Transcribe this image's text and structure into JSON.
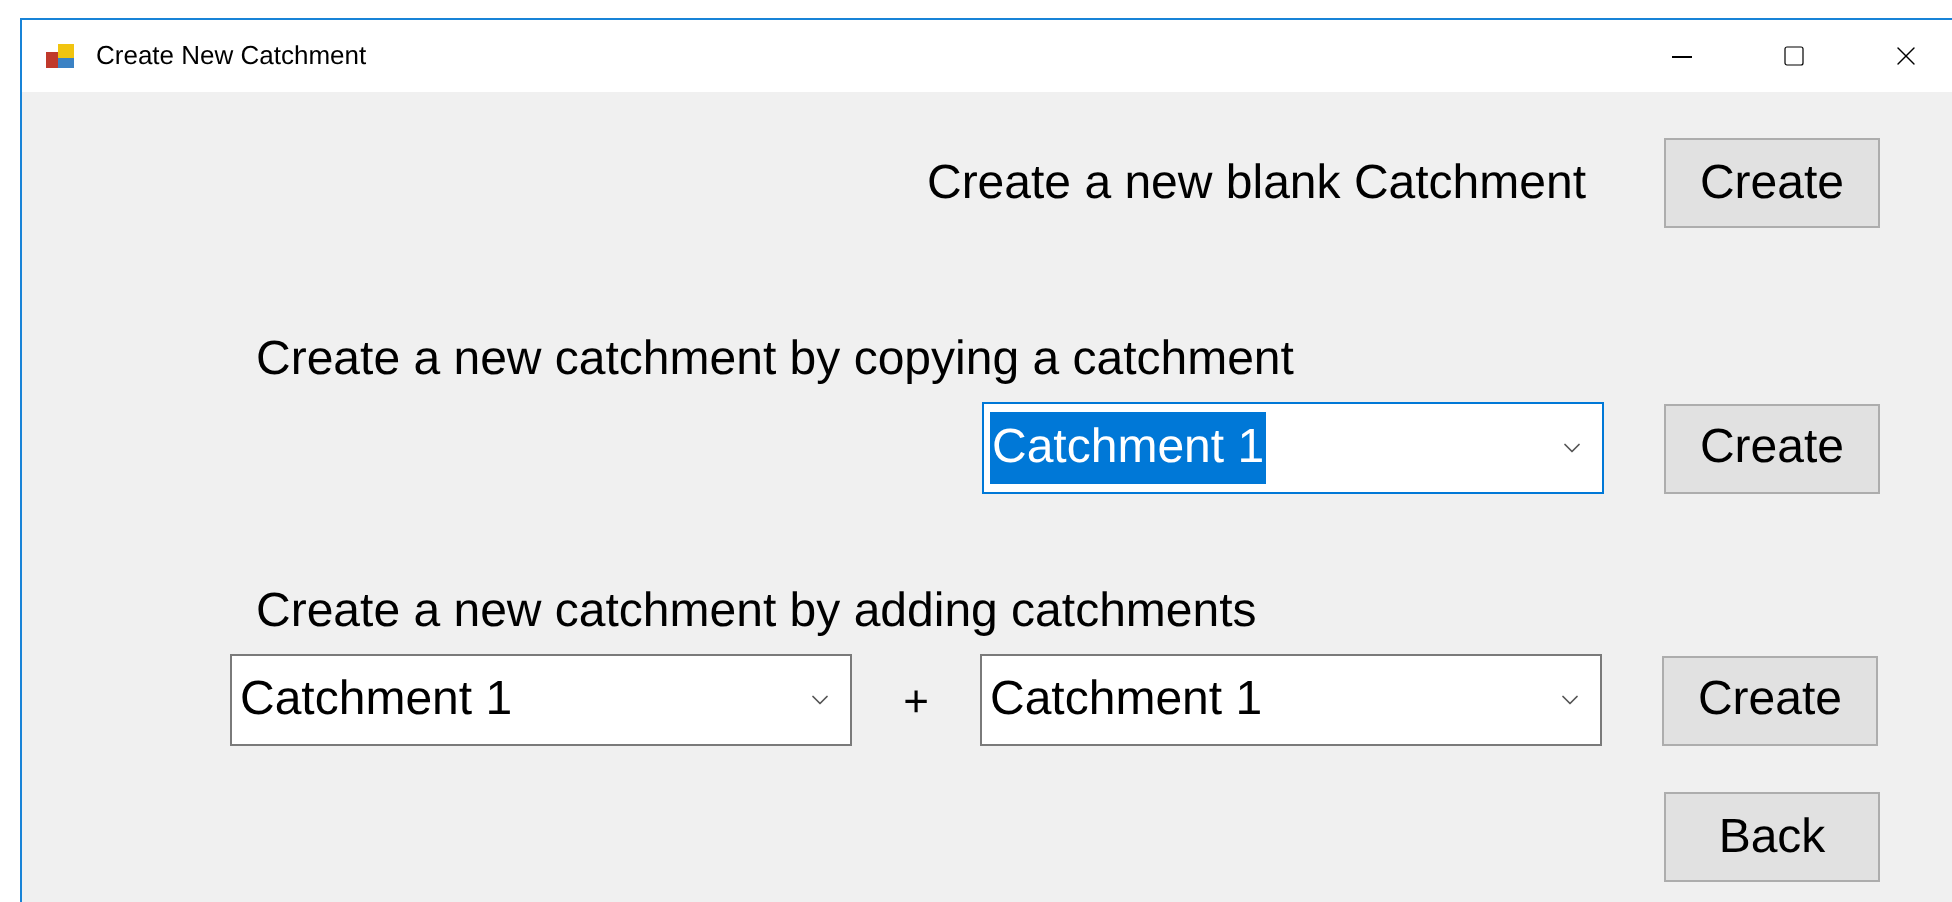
{
  "window": {
    "title": "Create New Catchment"
  },
  "blank_section": {
    "label": "Create a new blank Catchment",
    "button": "Create"
  },
  "copy_section": {
    "label": "Create a new catchment by copying a catchment",
    "combo": {
      "value": "Catchment 1",
      "focused": true
    },
    "button": "Create"
  },
  "add_section": {
    "label": "Create a new catchment by adding catchments",
    "combos": [
      {
        "value": "Catchment 1",
        "focused": false
      },
      {
        "value": "Catchment 1",
        "focused": false
      }
    ],
    "operator": "+",
    "button": "Create"
  },
  "back_button": "Back"
}
